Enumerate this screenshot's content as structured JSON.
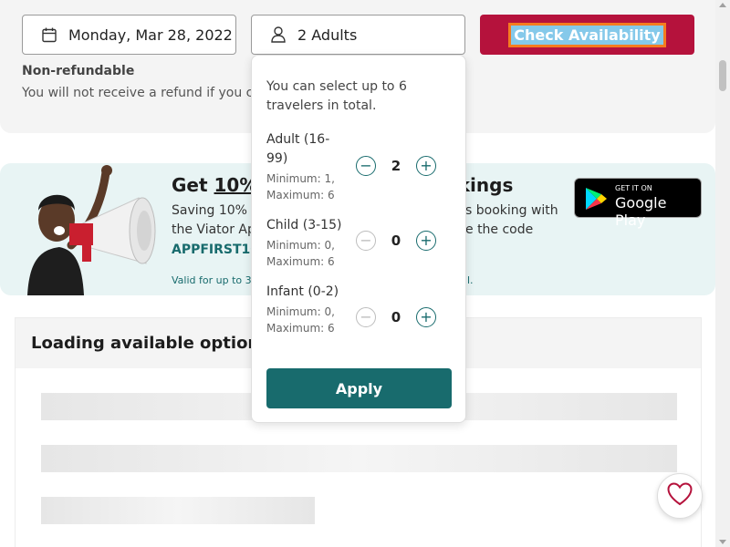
{
  "booking": {
    "date_value": "Monday, Mar 28, 2022",
    "travelers_value": "2 Adults",
    "check_availability_label": "Check Availability",
    "nonrefundable_title": "Non-refundable",
    "nonrefundable_text": "You will not receive a refund if you c"
  },
  "promo": {
    "title_prefix": "Get ",
    "title_underlined": "10%",
    "title_suffix": "okings",
    "line1": "Saving 10% o",
    "line1_right": "s booking with",
    "line2": "the Viator Ap",
    "line2_right": "e the code",
    "code": "APPFIRST10",
    "fine_print": "Valid for up to 3 b",
    "fine_print_right": "l.",
    "store_badge_small": "GET IT ON",
    "store_badge_big": "Google Play"
  },
  "options": {
    "header": "Loading available options"
  },
  "traveler_popover": {
    "intro": "You can select up to 6 travelers in total.",
    "rows": [
      {
        "label": "Adult (16-99)",
        "minmax": "Minimum: 1, Maximum: 6",
        "value": "2"
      },
      {
        "label": "Child (3-15)",
        "minmax": "Minimum: 0, Maximum: 6",
        "value": "0"
      },
      {
        "label": "Infant (0-2)",
        "minmax": "Minimum: 0, Maximum: 6",
        "value": "0"
      }
    ],
    "apply_label": "Apply"
  },
  "icons": {
    "calendar": "calendar-icon",
    "person": "person-icon",
    "minus": "minus-circle-icon",
    "plus": "plus-circle-icon",
    "heart": "heart-icon",
    "play": "google-play-icon"
  },
  "colors": {
    "primary_button": "#b5123c",
    "accent_teal": "#186b6d",
    "promo_bg": "#e8f4f4"
  }
}
